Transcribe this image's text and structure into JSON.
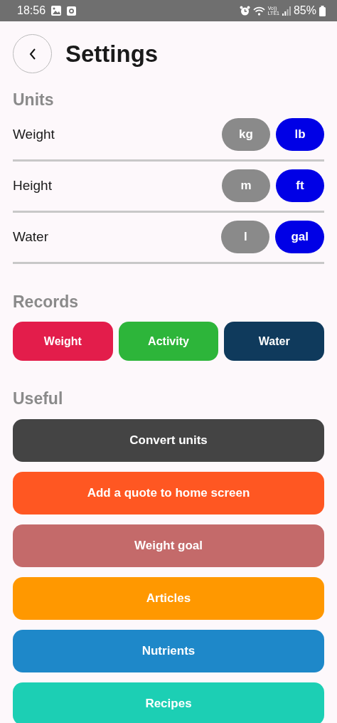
{
  "status_bar": {
    "time": "18:56",
    "volte": "Vo))",
    "network": "LTE1",
    "battery": "85%"
  },
  "header": {
    "title": "Settings"
  },
  "units": {
    "heading": "Units",
    "rows": [
      {
        "label": "Weight",
        "options": [
          {
            "label": "kg",
            "selected": false
          },
          {
            "label": "lb",
            "selected": true
          }
        ]
      },
      {
        "label": "Height",
        "options": [
          {
            "label": "m",
            "selected": false
          },
          {
            "label": "ft",
            "selected": true
          }
        ]
      },
      {
        "label": "Water",
        "options": [
          {
            "label": "l",
            "selected": false
          },
          {
            "label": "gal",
            "selected": true
          }
        ]
      }
    ]
  },
  "records": {
    "heading": "Records",
    "buttons": [
      {
        "label": "Weight",
        "color": "#e31d4b"
      },
      {
        "label": "Activity",
        "color": "#2db53a"
      },
      {
        "label": "Water",
        "color": "#0f3a5c"
      }
    ]
  },
  "useful": {
    "heading": "Useful",
    "buttons": [
      {
        "label": "Convert units",
        "color": "#444444"
      },
      {
        "label": "Add a quote to home screen",
        "color": "#ff5722"
      },
      {
        "label": "Weight goal",
        "color": "#c46a6a"
      },
      {
        "label": "Articles",
        "color": "#ff9800"
      },
      {
        "label": "Nutrients",
        "color": "#1e88c9"
      },
      {
        "label": "Recipes",
        "color": "#1ccfb4"
      }
    ]
  }
}
